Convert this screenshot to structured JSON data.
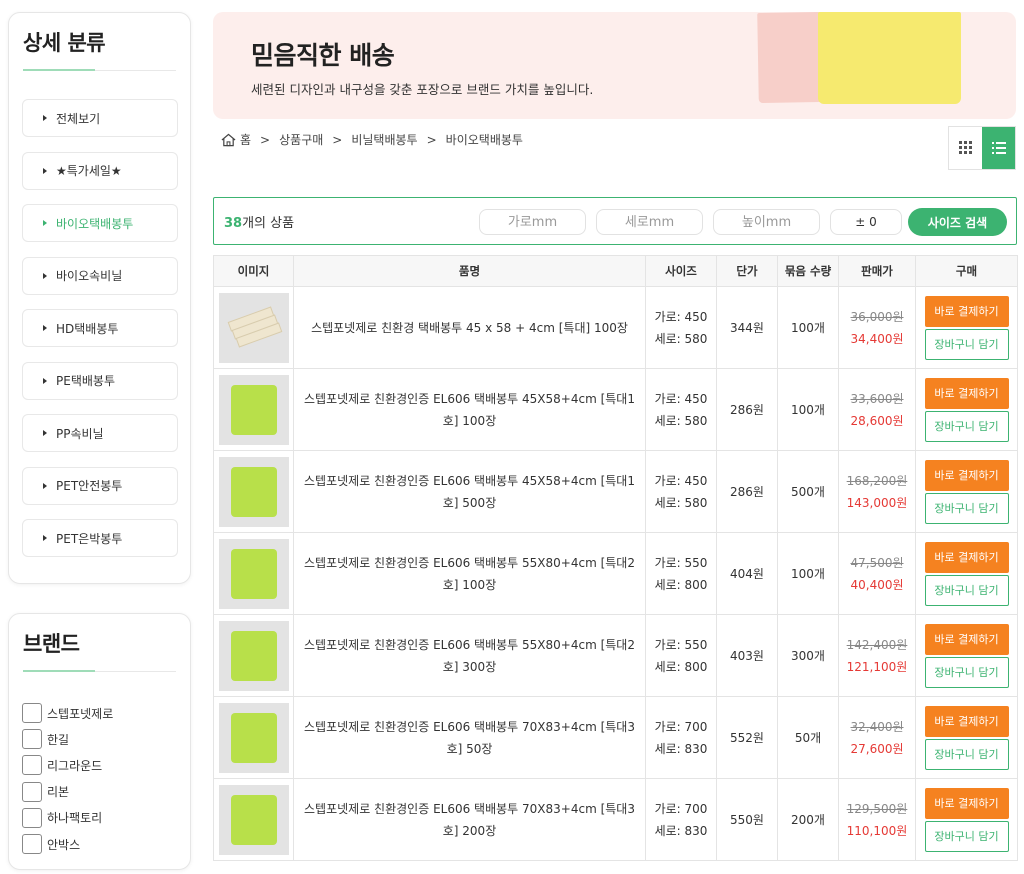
{
  "sidebar": {
    "title": "상세 분류",
    "items": [
      {
        "label": "전체보기"
      },
      {
        "label": "★특가세일★"
      },
      {
        "label": "바이오택배봉투"
      },
      {
        "label": "바이오속비닐"
      },
      {
        "label": "HD택배봉투"
      },
      {
        "label": "PE택배봉투"
      },
      {
        "label": "PP속비닐"
      },
      {
        "label": "PET안전봉투"
      },
      {
        "label": "PET은박봉투"
      }
    ],
    "active_index": 2
  },
  "brand": {
    "title": "브랜드",
    "items": [
      {
        "label": "스텝포넷제로"
      },
      {
        "label": "한길"
      },
      {
        "label": "리그라운드"
      },
      {
        "label": "리본"
      },
      {
        "label": "하나팩토리"
      },
      {
        "label": "안박스"
      }
    ]
  },
  "banner": {
    "title": "믿음직한 배송",
    "subtitle": "세련된 디자인과 내구성을 갖춘 포장으로 브랜드 가치를 높입니다."
  },
  "breadcrumb": {
    "home": "홈",
    "items": [
      "상품구매",
      "비닐택배봉투",
      "바이오택배봉투"
    ],
    "separator": ">"
  },
  "count": {
    "number": "38",
    "suffix": "개의 상품"
  },
  "size_search": {
    "width_placeholder": "가로mm",
    "depth_placeholder": "세로mm",
    "height_placeholder": "높이mm",
    "tolerance": "± 0",
    "button": "사이즈 검색"
  },
  "table": {
    "headers": [
      "이미지",
      "품명",
      "사이즈",
      "단가",
      "묶음 수량",
      "판매가",
      "구매"
    ],
    "buy_label": "바로 결제하기",
    "cart_label": "장바구니 담기",
    "rows": [
      {
        "name": "스텝포넷제로 친환경 택배봉투 45 x 58 + 4cm [특대] 100장",
        "size_w": "가로: 450",
        "size_h": "세로: 580",
        "unit": "344원",
        "qty": "100개",
        "orig": "36,000원",
        "sale": "34,400원",
        "thumb": "envelope"
      },
      {
        "name": "스텝포넷제로 친환경인증  EL606 택배봉투 45X58+4cm [특대1호] 100장",
        "size_w": "가로: 450",
        "size_h": "세로: 580",
        "unit": "286원",
        "qty": "100개",
        "orig": "33,600원",
        "sale": "28,600원",
        "thumb": "green"
      },
      {
        "name": "스텝포넷제로 친환경인증  EL606 택배봉투 45X58+4cm [특대1호] 500장",
        "size_w": "가로: 450",
        "size_h": "세로: 580",
        "unit": "286원",
        "qty": "500개",
        "orig": "168,200원",
        "sale": "143,000원",
        "thumb": "green"
      },
      {
        "name": "스텝포넷제로 친환경인증  EL606 택배봉투 55X80+4cm [특대2호] 100장",
        "size_w": "가로: 550",
        "size_h": "세로: 800",
        "unit": "404원",
        "qty": "100개",
        "orig": "47,500원",
        "sale": "40,400원",
        "thumb": "green"
      },
      {
        "name": "스텝포넷제로 친환경인증  EL606 택배봉투 55X80+4cm [특대2호] 300장",
        "size_w": "가로: 550",
        "size_h": "세로: 800",
        "unit": "403원",
        "qty": "300개",
        "orig": "142,400원",
        "sale": "121,100원",
        "thumb": "green"
      },
      {
        "name": "스텝포넷제로 친환경인증  EL606 택배봉투 70X83+4cm [특대3호] 50장",
        "size_w": "가로: 700",
        "size_h": "세로: 830",
        "unit": "552원",
        "qty": "50개",
        "orig": "32,400원",
        "sale": "27,600원",
        "thumb": "green"
      },
      {
        "name": "스텝포넷제로 친환경인증  EL606 택배봉투 70X83+4cm [특대3호] 200장",
        "size_w": "가로: 700",
        "size_h": "세로: 830",
        "unit": "550원",
        "qty": "200개",
        "orig": "129,500원",
        "sale": "110,100원",
        "thumb": "green"
      }
    ]
  },
  "colors": {
    "accent": "#3cb371",
    "buy": "#f58220",
    "sale": "#e53935",
    "banner_bg": "#fdeeec"
  }
}
